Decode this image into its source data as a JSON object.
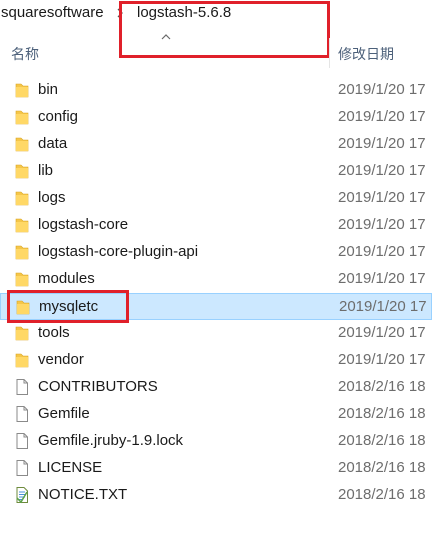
{
  "breadcrumb": {
    "parent": "squaresoftware",
    "current": "logstash-5.6.8"
  },
  "columns": {
    "name": "名称",
    "date_modified": "修改日期"
  },
  "colors": {
    "highlight": "#e0202a",
    "selection": "#cce8ff",
    "folder": "#f5c64a"
  },
  "files": [
    {
      "name": "bin",
      "date": "2019/1/20 17",
      "type": "folder"
    },
    {
      "name": "config",
      "date": "2019/1/20 17",
      "type": "folder"
    },
    {
      "name": "data",
      "date": "2019/1/20 17",
      "type": "folder"
    },
    {
      "name": "lib",
      "date": "2019/1/20 17",
      "type": "folder"
    },
    {
      "name": "logs",
      "date": "2019/1/20 17",
      "type": "folder"
    },
    {
      "name": "logstash-core",
      "date": "2019/1/20 17",
      "type": "folder"
    },
    {
      "name": "logstash-core-plugin-api",
      "date": "2019/1/20 17",
      "type": "folder"
    },
    {
      "name": "modules",
      "date": "2019/1/20 17",
      "type": "folder"
    },
    {
      "name": "mysqletc",
      "date": "2019/1/20 17",
      "type": "folder",
      "selected": true
    },
    {
      "name": "tools",
      "date": "2019/1/20 17",
      "type": "folder"
    },
    {
      "name": "vendor",
      "date": "2019/1/20 17",
      "type": "folder"
    },
    {
      "name": "CONTRIBUTORS",
      "date": "2018/2/16 18",
      "type": "file"
    },
    {
      "name": "Gemfile",
      "date": "2018/2/16 18",
      "type": "file"
    },
    {
      "name": "Gemfile.jruby-1.9.lock",
      "date": "2018/2/16 18",
      "type": "file"
    },
    {
      "name": "LICENSE",
      "date": "2018/2/16 18",
      "type": "file"
    },
    {
      "name": "NOTICE.TXT",
      "date": "2018/2/16 18",
      "type": "text-file"
    }
  ]
}
